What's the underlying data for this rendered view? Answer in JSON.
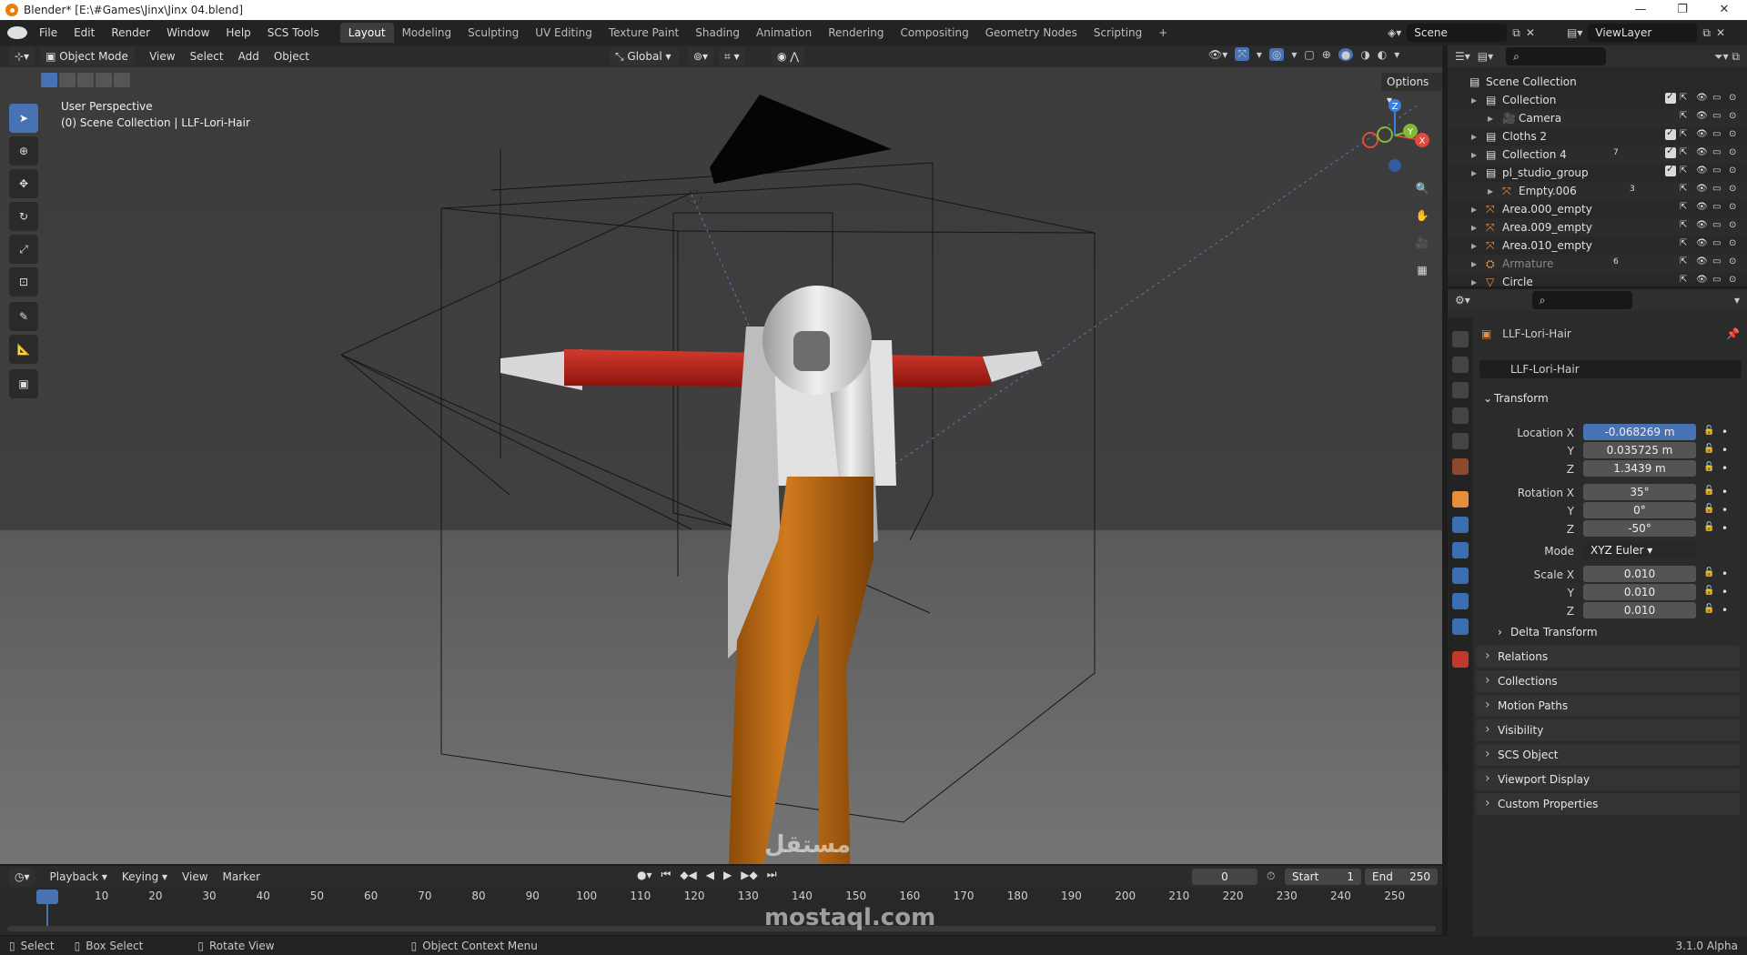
{
  "window": {
    "title": "Blender* [E:\\#Games\\Jinx\\Jinx 04.blend]"
  },
  "menubar": {
    "menus": [
      "File",
      "Edit",
      "Render",
      "Window",
      "Help",
      "SCS Tools"
    ],
    "workspaces": [
      "Layout",
      "Modeling",
      "Sculpting",
      "UV Editing",
      "Texture Paint",
      "Shading",
      "Animation",
      "Rendering",
      "Compositing",
      "Geometry Nodes",
      "Scripting"
    ],
    "active_workspace": "Layout",
    "add_tab": "+",
    "scene": "Scene",
    "view_layer": "ViewLayer"
  },
  "viewport": {
    "mode": "Object Mode",
    "menus": [
      "View",
      "Select",
      "Add",
      "Object"
    ],
    "orientation": "Global",
    "options": "Options",
    "perspective": "User Perspective",
    "collection_path": "(0) Scene Collection | LLF-Lori-Hair",
    "gizmo_axes": {
      "x": "X",
      "y": "Y",
      "z": "Z"
    }
  },
  "outliner": {
    "root": "Scene Collection",
    "items": [
      {
        "label": "Collection",
        "type": "collection"
      },
      {
        "label": "Camera",
        "type": "camera"
      },
      {
        "label": "Cloths 2",
        "type": "collection"
      },
      {
        "label": "Collection 4",
        "type": "collection",
        "badge": "7"
      },
      {
        "label": "pl_studio_group",
        "type": "collection"
      },
      {
        "label": "Empty.006",
        "type": "empty",
        "badge": "3"
      },
      {
        "label": "Area.000_empty",
        "type": "empty"
      },
      {
        "label": "Area.009_empty",
        "type": "empty"
      },
      {
        "label": "Area.010_empty",
        "type": "empty"
      },
      {
        "label": "Armature",
        "type": "armature",
        "badge": "6"
      },
      {
        "label": "Circle",
        "type": "mesh"
      }
    ]
  },
  "properties": {
    "object_name": "LLF-Lori-Hair",
    "data_name": "LLF-Lori-Hair",
    "transform_label": "Transform",
    "location": {
      "label_x": "Location X",
      "label_y": "Y",
      "label_z": "Z",
      "x": "-0.068269 m",
      "y": "0.035725 m",
      "z": "1.3439 m"
    },
    "rotation": {
      "label_x": "Rotation X",
      "label_y": "Y",
      "label_z": "Z",
      "x": "35°",
      "y": "0°",
      "z": "-50°"
    },
    "mode": {
      "label": "Mode",
      "value": "XYZ Euler"
    },
    "scale": {
      "label_x": "Scale X",
      "label_y": "Y",
      "label_z": "Z",
      "x": "0.010",
      "y": "0.010",
      "z": "0.010"
    },
    "delta_transform": "Delta Transform",
    "panels": [
      "Relations",
      "Collections",
      "Motion Paths",
      "Visibility",
      "SCS Object",
      "Viewport Display",
      "Custom Properties"
    ]
  },
  "timeline": {
    "menus": [
      "Playback",
      "Keying",
      "View",
      "Marker"
    ],
    "current_frame": "0",
    "start_label": "Start",
    "start": "1",
    "end_label": "End",
    "end": "250",
    "ticks": [
      "0",
      "10",
      "20",
      "30",
      "40",
      "50",
      "60",
      "70",
      "80",
      "90",
      "100",
      "110",
      "120",
      "130",
      "140",
      "150",
      "160",
      "170",
      "180",
      "190",
      "200",
      "210",
      "220",
      "230",
      "240",
      "250"
    ]
  },
  "statusbar": {
    "select": "Select",
    "box_select": "Box Select",
    "rotate_view": "Rotate View",
    "context_menu": "Object Context Menu",
    "version": "3.1.0 Alpha"
  },
  "watermark": {
    "arabic": "مستقل",
    "latin": "mostaql.com"
  },
  "colors": {
    "accent": "#4772b3",
    "jacket": "#b01c16",
    "pants": "#b8650f",
    "gizmo_x": "#e0493c",
    "gizmo_y": "#82b934",
    "gizmo_z": "#3c7ee0"
  }
}
